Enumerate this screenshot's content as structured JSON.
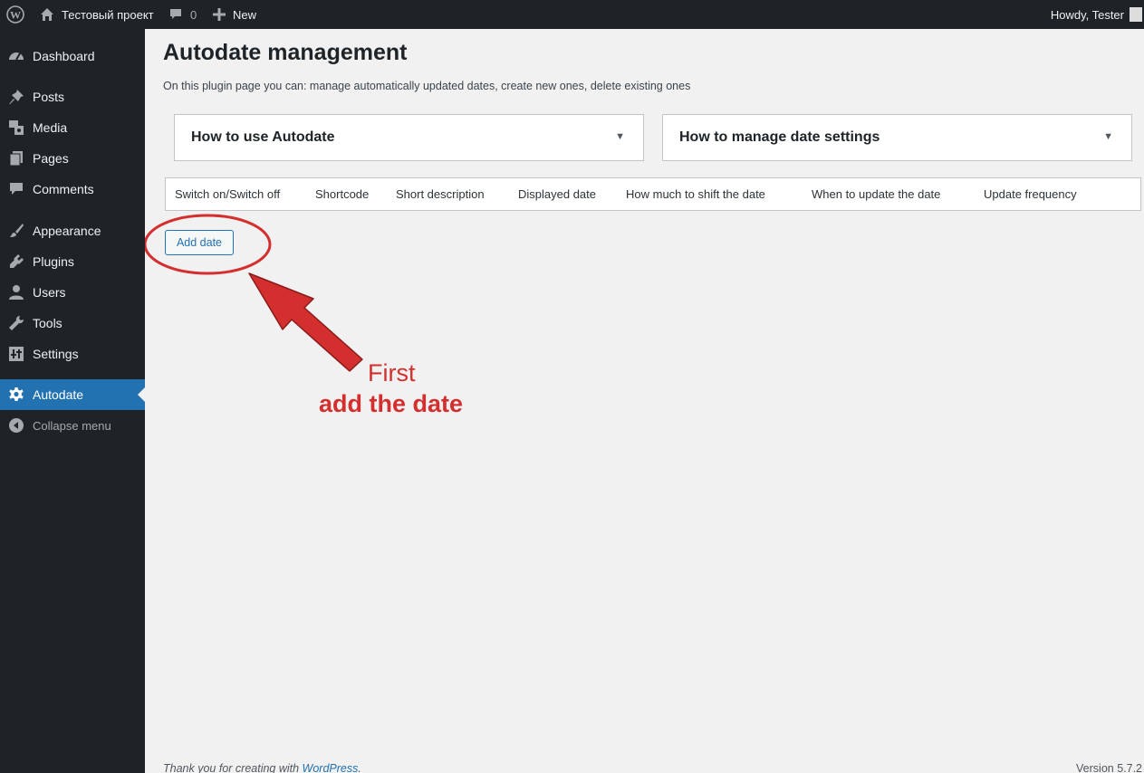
{
  "adminbar": {
    "site_name": "Тестовый проект",
    "comments_count": "0",
    "new_label": "New",
    "howdy": "Howdy, Tester",
    "icons": {
      "logo": "wordpress-icon",
      "home": "home-icon",
      "comments": "comment-icon",
      "new": "plus-icon"
    }
  },
  "sidebar": {
    "items": [
      {
        "label": "Dashboard",
        "icon": "dashboard-icon"
      },
      {
        "label": "Posts",
        "icon": "pin-icon"
      },
      {
        "label": "Media",
        "icon": "media-icon"
      },
      {
        "label": "Pages",
        "icon": "pages-icon"
      },
      {
        "label": "Comments",
        "icon": "comment-icon"
      },
      {
        "label": "Appearance",
        "icon": "brush-icon"
      },
      {
        "label": "Plugins",
        "icon": "plug-icon"
      },
      {
        "label": "Users",
        "icon": "user-icon"
      },
      {
        "label": "Tools",
        "icon": "wrench-icon"
      },
      {
        "label": "Settings",
        "icon": "settings-icon"
      },
      {
        "label": "Autodate",
        "icon": "gear-icon",
        "current": true
      },
      {
        "label": "Collapse menu",
        "icon": "collapse-icon"
      }
    ]
  },
  "main": {
    "title": "Autodate management",
    "description": "On this plugin page you can: manage automatically updated dates, create new ones, delete existing ones",
    "accordions": [
      {
        "label": "How to use Autodate"
      },
      {
        "label": "How to manage date settings"
      }
    ],
    "table_columns": [
      "Switch on/Switch off",
      "Shortcode",
      "Short description",
      "Displayed date",
      "How much to shift the date",
      "When to update the date",
      "Update frequency"
    ],
    "add_button": "Add date"
  },
  "annotation": {
    "line1": "First",
    "line2": "add the date",
    "color": "#d32f2f"
  },
  "footer": {
    "thanks_prefix": "Thank you for creating with ",
    "thanks_link": "WordPress",
    "thanks_suffix": ".",
    "version": "Version 5.7.2"
  },
  "colors": {
    "accent": "#2271b1",
    "sidebar_bg": "#1d2327",
    "content_bg": "#f1f1f1"
  }
}
